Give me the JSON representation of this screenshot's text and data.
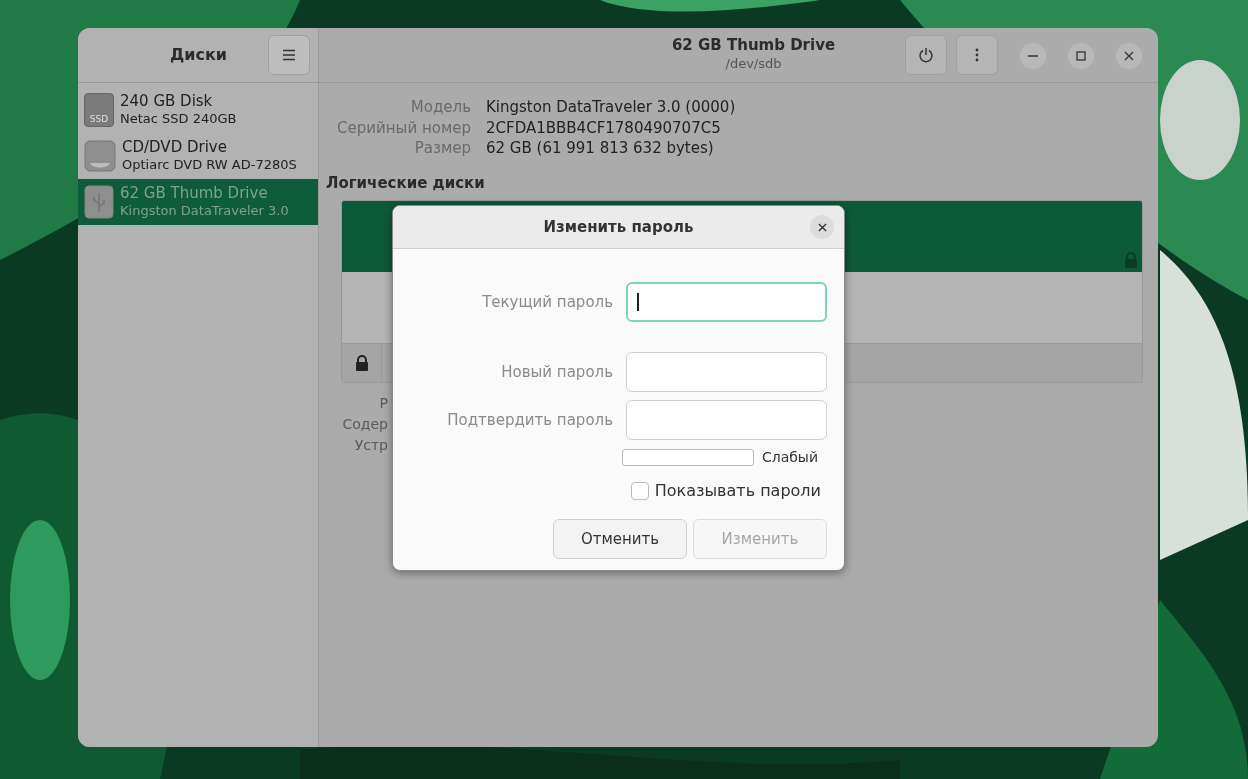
{
  "sidebar": {
    "title": "Диски",
    "items": [
      {
        "kind": "ssd",
        "icon_label": "SSD",
        "name": "240 GB Disk",
        "model": "Netac SSD 240GB",
        "selected": false
      },
      {
        "kind": "optical",
        "name": "CD/DVD Drive",
        "model": "Optiarc DVD RW AD-7280S",
        "selected": false
      },
      {
        "kind": "usb",
        "name": "62 GB Thumb Drive",
        "model": "Kingston DataTraveler 3.0",
        "selected": true
      }
    ]
  },
  "header": {
    "title": "62 GB Thumb Drive",
    "subtitle": "/dev/sdb"
  },
  "details": [
    {
      "label": "Модель",
      "value": "Kingston DataTraveler 3.0 (0000)"
    },
    {
      "label": "Серийный номер",
      "value": "2CFDA1BBB4CF1780490707C5"
    },
    {
      "label": "Размер",
      "value": "62 GB (61 991 813 632 bytes)"
    }
  ],
  "volumes": {
    "title": "Логические диски"
  },
  "partial_labels": [
    "Р",
    "Содер",
    "Устр"
  ],
  "dialog": {
    "title": "Изменить пароль",
    "fields": [
      {
        "label": "Текущий пароль",
        "focused": true
      },
      {
        "label": "Новый пароль",
        "focused": false
      },
      {
        "label": "Подтвердить пароль",
        "focused": false
      }
    ],
    "strength": {
      "level": 0,
      "reading": "Слабый"
    },
    "show_passwords": {
      "label": "Показывать пароли",
      "checked": false
    },
    "buttons": [
      {
        "label": "Отменить",
        "disabled": false
      },
      {
        "label": "Изменить",
        "disabled": true
      }
    ]
  }
}
